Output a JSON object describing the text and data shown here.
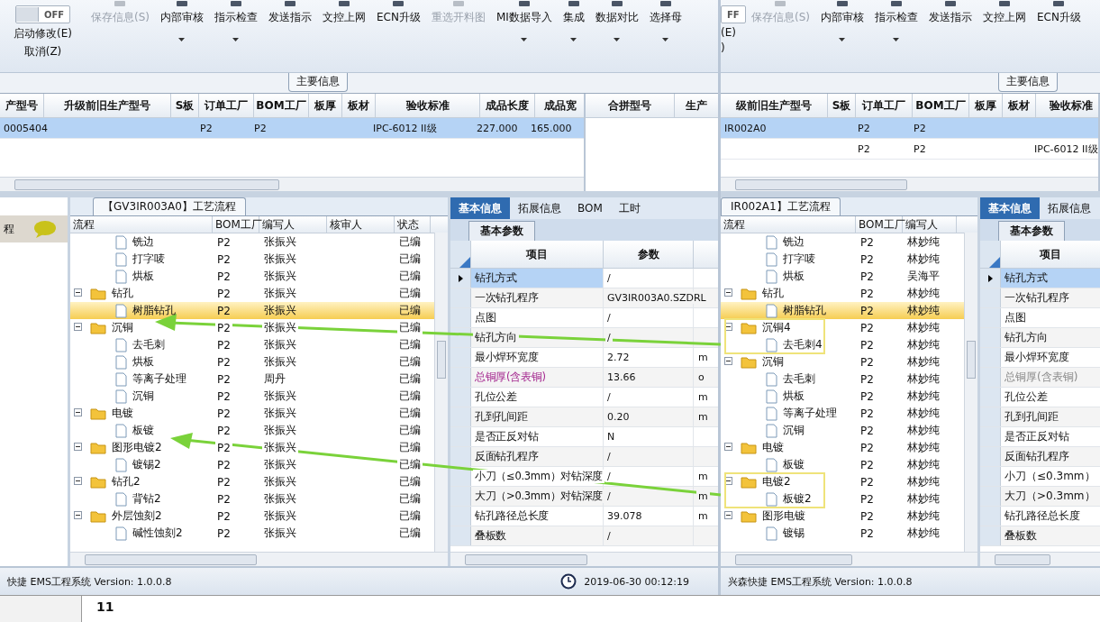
{
  "panes": [
    {
      "toggle": {
        "label": "OFF",
        "on": false
      },
      "edit_actions": [
        "启动修改(E)",
        "取消(Z)"
      ],
      "toolbar": [
        {
          "label": "保存信息(S)",
          "disabled": true,
          "dropdown": false
        },
        {
          "label": "内部审核",
          "disabled": false,
          "dropdown": true
        },
        {
          "label": "指示检查",
          "disabled": false,
          "dropdown": true
        },
        {
          "label": "发送指示",
          "disabled": false,
          "dropdown": false
        },
        {
          "label": "文控上网",
          "disabled": false,
          "dropdown": false
        },
        {
          "label": "ECN升级",
          "disabled": false,
          "dropdown": false
        },
        {
          "label": "重选开料图",
          "disabled": true,
          "dropdown": false
        },
        {
          "label": "MI数据导入",
          "disabled": false,
          "dropdown": true
        },
        {
          "label": "集成",
          "disabled": false,
          "dropdown": true
        },
        {
          "label": "数据对比",
          "disabled": false,
          "dropdown": true
        },
        {
          "label": "选择母",
          "disabled": false,
          "dropdown": true
        }
      ],
      "section_title": "主要信息",
      "main_table": {
        "columns": [
          "产型号",
          "升级前旧生产型号",
          "S板",
          "订单工厂",
          "BOM工厂",
          "板厚",
          "板材",
          "验收标准",
          "成品长度",
          "成品宽"
        ],
        "rows": [
          {
            "selected": true,
            "cells": [
              "0005404",
              "",
              "",
              "P2",
              "P2",
              "",
              "",
              "IPC-6012 II级",
              "227.000",
              "165.000"
            ]
          }
        ]
      },
      "merge_table": {
        "columns": [
          "合拼型号",
          "生产"
        ]
      },
      "side_label": "程",
      "tree_title": "【GV3IR003A0】工艺流程",
      "tree": {
        "columns": [
          "流程",
          "BOM工厂",
          "编写人",
          "核审人",
          "状态"
        ],
        "rows": [
          {
            "kind": "file",
            "name": "铣边",
            "bom": "P2",
            "author": "张振兴",
            "status": "已编",
            "selected": false
          },
          {
            "kind": "file",
            "name": "打字唛",
            "bom": "P2",
            "author": "张振兴",
            "status": "已编",
            "selected": false
          },
          {
            "kind": "file",
            "name": "烘板",
            "bom": "P2",
            "author": "张振兴",
            "status": "已编",
            "selected": false
          },
          {
            "kind": "folder",
            "name": "钻孔",
            "bom": "P2",
            "author": "张振兴",
            "status": "已编",
            "selected": false,
            "expanded": true,
            "children": [
              {
                "kind": "file",
                "name": "树脂钻孔",
                "bom": "P2",
                "author": "张振兴",
                "status": "已编",
                "selected": true
              }
            ]
          },
          {
            "kind": "folder",
            "name": "沉铜",
            "bom": "P2",
            "author": "张振兴",
            "status": "已编",
            "selected": false,
            "expanded": true,
            "children": [
              {
                "kind": "file",
                "name": "去毛刺",
                "bom": "P2",
                "author": "张振兴",
                "status": "已编",
                "selected": false
              },
              {
                "kind": "file",
                "name": "烘板",
                "bom": "P2",
                "author": "张振兴",
                "status": "已编",
                "selected": false
              },
              {
                "kind": "file",
                "name": "等离子处理",
                "bom": "P2",
                "author": "周丹",
                "status": "已编",
                "selected": false
              },
              {
                "kind": "file",
                "name": "沉铜",
                "bom": "P2",
                "author": "张振兴",
                "status": "已编",
                "selected": false
              }
            ]
          },
          {
            "kind": "folder",
            "name": "电镀",
            "bom": "P2",
            "author": "张振兴",
            "status": "已编",
            "selected": false,
            "expanded": true,
            "children": [
              {
                "kind": "file",
                "name": "板镀",
                "bom": "P2",
                "author": "张振兴",
                "status": "已编",
                "selected": false
              }
            ]
          },
          {
            "kind": "folder",
            "name": "图形电镀2",
            "bom": "P2",
            "author": "张振兴",
            "status": "已编",
            "selected": false,
            "expanded": true,
            "children": [
              {
                "kind": "file",
                "name": "镀锡2",
                "bom": "P2",
                "author": "张振兴",
                "status": "已编",
                "selected": false
              }
            ]
          },
          {
            "kind": "folder",
            "name": "钻孔2",
            "bom": "P2",
            "author": "张振兴",
            "status": "已编",
            "selected": false,
            "expanded": true,
            "children": [
              {
                "kind": "file",
                "name": "背钻2",
                "bom": "P2",
                "author": "张振兴",
                "status": "已编",
                "selected": false
              }
            ]
          },
          {
            "kind": "folder",
            "name": "外层蚀刻2",
            "bom": "P2",
            "author": "张振兴",
            "status": "已编",
            "selected": false,
            "expanded": true,
            "children": [
              {
                "kind": "file",
                "name": "碱性蚀刻2",
                "bom": "P2",
                "author": "张振兴",
                "status": "已编",
                "selected": false
              }
            ]
          }
        ]
      },
      "props": {
        "tabs": [
          {
            "label": "基本信息",
            "selected": true
          },
          {
            "label": "拓展信息",
            "selected": false
          },
          {
            "label": "BOM",
            "selected": false
          },
          {
            "label": "工时",
            "selected": false
          }
        ],
        "subtab": "基本参数",
        "columns": [
          "项目",
          "参数"
        ],
        "rows": [
          {
            "kind": "normal",
            "item": "钻孔方式",
            "value": "/",
            "unit": "",
            "selected": true
          },
          {
            "kind": "normal",
            "item": "一次钻孔程序",
            "value": "GV3IR003A0.SZDRL",
            "unit": "",
            "selected": false
          },
          {
            "kind": "normal",
            "item": "点图",
            "value": "/",
            "unit": "",
            "selected": false
          },
          {
            "kind": "normal",
            "item": "钻孔方向",
            "value": "/",
            "unit": "",
            "selected": false
          },
          {
            "kind": "normal",
            "item": "最小焊环宽度",
            "value": "2.72",
            "unit": "m",
            "selected": false
          },
          {
            "kind": "accent",
            "item": "总铜厚(含表铜)",
            "value": "13.66",
            "unit": "o",
            "selected": false
          },
          {
            "kind": "normal",
            "item": "孔位公差",
            "value": "/",
            "unit": "m",
            "selected": false
          },
          {
            "kind": "normal",
            "item": "孔到孔间距",
            "value": "0.20",
            "unit": "m",
            "selected": false
          },
          {
            "kind": "normal",
            "item": "是否正反对钻",
            "value": "N",
            "unit": "",
            "selected": false
          },
          {
            "kind": "normal",
            "item": "反面钻孔程序",
            "value": "/",
            "unit": "",
            "selected": false
          },
          {
            "kind": "normal",
            "item": "小刀（≤0.3mm）对钻深度",
            "value": "/",
            "unit": "m",
            "selected": false
          },
          {
            "kind": "normal",
            "item": "大刀（>0.3mm）对钻深度",
            "value": "/",
            "unit": "m",
            "selected": false
          },
          {
            "kind": "normal",
            "item": "钻孔路径总长度",
            "value": "39.078",
            "unit": "m",
            "selected": false
          },
          {
            "kind": "normal",
            "item": "叠板数",
            "value": "/",
            "unit": "",
            "selected": false
          }
        ]
      },
      "status": {
        "text": "快捷 EMS工程系统 Version: 1.0.0.8",
        "time": "2019-06-30 00:12:19"
      }
    },
    {
      "toggle": {
        "label": "FF",
        "on": false
      },
      "edit_actions": [
        "(E)",
        ")"
      ],
      "toolbar": [
        {
          "label": "保存信息(S)",
          "disabled": true,
          "dropdown": false
        },
        {
          "label": "内部审核",
          "disabled": false,
          "dropdown": true
        },
        {
          "label": "指示检查",
          "disabled": false,
          "dropdown": true
        },
        {
          "label": "发送指示",
          "disabled": false,
          "dropdown": false
        },
        {
          "label": "文控上网",
          "disabled": false,
          "dropdown": false
        },
        {
          "label": "ECN升级",
          "disabled": false,
          "dropdown": false
        }
      ],
      "section_title": "主要信息",
      "main_table": {
        "columns": [
          "级前旧生产型号",
          "S板",
          "订单工厂",
          "BOM工厂",
          "板厚",
          "板材",
          "验收标准"
        ],
        "rows": [
          {
            "selected": true,
            "cells": [
              "IR002A0",
              "",
              "P2",
              "P2",
              "",
              "",
              ""
            ]
          },
          {
            "selected": false,
            "cells": [
              "",
              "",
              "P2",
              "P2",
              "",
              "",
              "IPC-6012 II级"
            ]
          }
        ]
      },
      "tree_title": "IR002A1】工艺流程",
      "tree": {
        "columns": [
          "流程",
          "BOM工厂",
          "编写人"
        ],
        "rows": [
          {
            "kind": "file",
            "name": "铣边",
            "bom": "P2",
            "author": "林妙纯",
            "selected": false
          },
          {
            "kind": "file",
            "name": "打字唛",
            "bom": "P2",
            "author": "林妙纯",
            "selected": false
          },
          {
            "kind": "file",
            "name": "烘板",
            "bom": "P2",
            "author": "吴海平",
            "selected": false
          },
          {
            "kind": "folder",
            "name": "钻孔",
            "bom": "P2",
            "author": "林妙纯",
            "selected": false,
            "expanded": true,
            "highlighted": false,
            "children": [
              {
                "kind": "file",
                "name": "树脂钻孔",
                "bom": "P2",
                "author": "林妙纯",
                "selected": true
              }
            ]
          },
          {
            "kind": "folder",
            "name": "沉铜4",
            "bom": "P2",
            "author": "林妙纯",
            "selected": false,
            "expanded": true,
            "highlighted": true,
            "children": [
              {
                "kind": "file",
                "name": "去毛刺4",
                "bom": "P2",
                "author": "林妙纯",
                "selected": false
              }
            ]
          },
          {
            "kind": "folder",
            "name": "沉铜",
            "bom": "P2",
            "author": "林妙纯",
            "selected": false,
            "expanded": true,
            "highlighted": false,
            "children": [
              {
                "kind": "file",
                "name": "去毛刺",
                "bom": "P2",
                "author": "林妙纯",
                "selected": false
              },
              {
                "kind": "file",
                "name": "烘板",
                "bom": "P2",
                "author": "林妙纯",
                "selected": false
              },
              {
                "kind": "file",
                "name": "等离子处理",
                "bom": "P2",
                "author": "林妙纯",
                "selected": false
              },
              {
                "kind": "file",
                "name": "沉铜",
                "bom": "P2",
                "author": "林妙纯",
                "selected": false
              }
            ]
          },
          {
            "kind": "folder",
            "name": "电镀",
            "bom": "P2",
            "author": "林妙纯",
            "selected": false,
            "expanded": true,
            "highlighted": false,
            "children": [
              {
                "kind": "file",
                "name": "板镀",
                "bom": "P2",
                "author": "林妙纯",
                "selected": false
              }
            ]
          },
          {
            "kind": "folder",
            "name": "电镀2",
            "bom": "P2",
            "author": "林妙纯",
            "selected": false,
            "expanded": true,
            "highlighted": true,
            "children": [
              {
                "kind": "file",
                "name": "板镀2",
                "bom": "P2",
                "author": "林妙纯",
                "selected": false
              }
            ]
          },
          {
            "kind": "folder",
            "name": "图形电镀",
            "bom": "P2",
            "author": "林妙纯",
            "selected": false,
            "expanded": true,
            "highlighted": false,
            "children": [
              {
                "kind": "file",
                "name": "镀锡",
                "bom": "P2",
                "author": "林妙纯",
                "selected": false
              }
            ]
          }
        ]
      },
      "props": {
        "tabs": [
          {
            "label": "基本信息",
            "selected": true
          },
          {
            "label": "拓展信息",
            "selected": false
          }
        ],
        "subtab": "基本参数",
        "columns": [
          "项目"
        ],
        "rows": [
          {
            "kind": "normal",
            "item": "钻孔方式",
            "selected": true
          },
          {
            "kind": "normal",
            "item": "一次钻孔程序",
            "selected": false
          },
          {
            "kind": "normal",
            "item": "点图",
            "selected": false
          },
          {
            "kind": "normal",
            "item": "钻孔方向",
            "selected": false
          },
          {
            "kind": "normal",
            "item": "最小焊环宽度",
            "selected": false
          },
          {
            "kind": "muted",
            "item": "总铜厚(含表铜)",
            "selected": false
          },
          {
            "kind": "normal",
            "item": "孔位公差",
            "selected": false
          },
          {
            "kind": "normal",
            "item": "孔到孔间距",
            "selected": false
          },
          {
            "kind": "normal",
            "item": "是否正反对钻",
            "selected": false
          },
          {
            "kind": "normal",
            "item": "反面钻孔程序",
            "selected": false
          },
          {
            "kind": "normal",
            "item": "小刀（≤0.3mm）",
            "selected": false
          },
          {
            "kind": "normal",
            "item": "大刀（>0.3mm）",
            "selected": false
          },
          {
            "kind": "normal",
            "item": "钻孔路径总长度",
            "selected": false
          },
          {
            "kind": "normal",
            "item": "叠板数",
            "selected": false
          }
        ]
      },
      "status": {
        "text": "兴森快捷 EMS工程系统 Version: 1.0.0.8"
      }
    }
  ],
  "sheet": {
    "cell": "11"
  }
}
